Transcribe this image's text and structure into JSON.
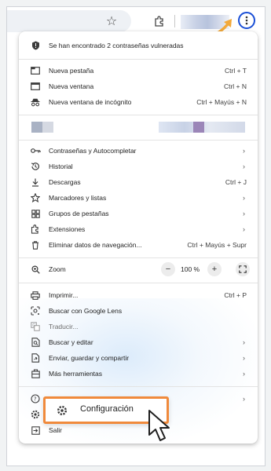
{
  "toolbar": {
    "icons": [
      "star-icon",
      "extensions-icon",
      "profile-avatar",
      "more-vert-icon"
    ]
  },
  "menu": {
    "warning": "Se han encontrado 2 contraseñas vulneradas",
    "items_top": [
      {
        "label": "Nueva pestaña",
        "shortcut": "Ctrl + T",
        "icon": "new-tab-icon"
      },
      {
        "label": "Nueva ventana",
        "shortcut": "Ctrl + N",
        "icon": "new-window-icon"
      },
      {
        "label": "Nueva ventana de incógnito",
        "shortcut": "Ctrl + Mayús + N",
        "icon": "incognito-icon"
      }
    ],
    "items_mid": [
      {
        "label": "Contraseñas y Autocompletar",
        "icon": "key-icon"
      },
      {
        "label": "Historial",
        "icon": "history-icon"
      },
      {
        "label": "Descargas",
        "shortcut": "Ctrl + J",
        "icon": "download-icon"
      },
      {
        "label": "Marcadores y listas",
        "icon": "star-icon"
      },
      {
        "label": "Grupos de pestañas",
        "icon": "tab-groups-icon"
      },
      {
        "label": "Extensiones",
        "icon": "extensions-icon"
      },
      {
        "label": "Eliminar datos de navegación...",
        "shortcut": "Ctrl + Mayús + Supr",
        "icon": "trash-icon"
      }
    ],
    "zoom": {
      "label": "Zoom",
      "value": "100 %",
      "minus": "−",
      "plus": "+"
    },
    "items_tools": [
      {
        "label": "Imprimir...",
        "shortcut": "Ctrl + P",
        "icon": "print-icon"
      },
      {
        "label": "Buscar con Google Lens",
        "icon": "lens-icon"
      },
      {
        "label": "Traducir...",
        "icon": "translate-icon"
      },
      {
        "label": "Buscar y editar",
        "icon": "find-icon"
      },
      {
        "label": "Enviar, guardar y compartir",
        "icon": "share-icon"
      },
      {
        "label": "Más herramientas",
        "icon": "tools-icon"
      }
    ],
    "settings_label": "Configuración",
    "exit_label": "Salir"
  },
  "colors": {
    "highlight_border": "#f08a3c",
    "menu_button_ring": "#1a4fd6",
    "arrow": "#f2a93b"
  }
}
